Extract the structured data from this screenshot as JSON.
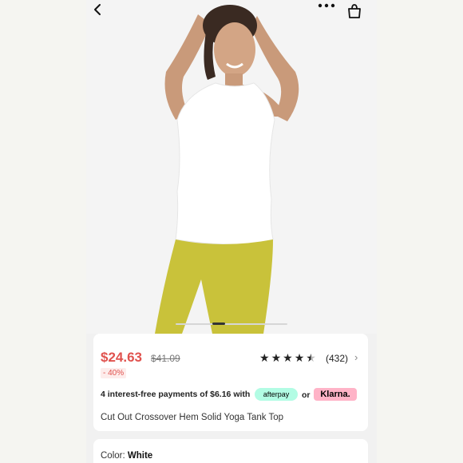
{
  "product": {
    "price": "$24.63",
    "old_price": "$41.09",
    "discount": "- 40%",
    "rating_count": "(432)",
    "title": "Cut Out Crossover Hem Solid Yoga Tank Top"
  },
  "payments": {
    "text": "4 interest-free payments of $6.16 with",
    "afterpay_label": "afterpay",
    "or_label": "or",
    "klarna_label": "Klarna."
  },
  "color_selector": {
    "label": "Color:",
    "value": "White"
  },
  "rating": {
    "stars": 4.5
  },
  "icons": {
    "back": "chevron-left-icon",
    "more": "more-dots-icon",
    "bag": "shopping-bag-icon",
    "chevron": "chevron-right-icon"
  },
  "colors": {
    "price": "#e0524e",
    "afterpay_bg": "#b2fce4",
    "klarna_bg": "#ffb3c7",
    "leggings": "#c9c23a",
    "tank": "#ffffff"
  },
  "gallery": {
    "total_slides": 5,
    "active_slide": 1
  }
}
